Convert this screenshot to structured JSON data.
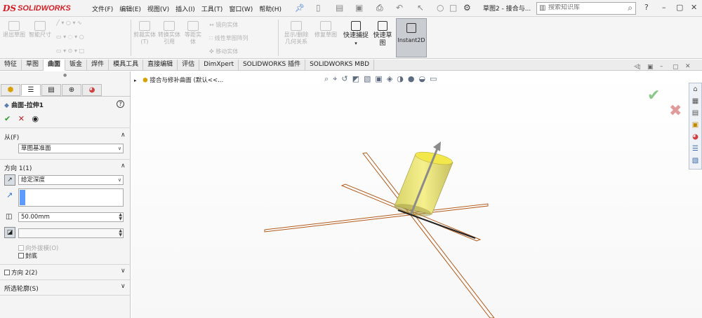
{
  "app": {
    "logo_mark": "DS",
    "logo_text": "SOLIDWORKS",
    "brand_color": "#d32027"
  },
  "menu": {
    "items": [
      "文件(F)",
      "编辑(E)",
      "视图(V)",
      "插入(I)",
      "工具(T)",
      "窗口(W)",
      "帮助(H)"
    ],
    "pin_icon": "pin-icon"
  },
  "titlebar": {
    "doc_title": "草图2 - 接合与...",
    "search_placeholder": "搜索知识库",
    "help": "?"
  },
  "ribbon": {
    "exit_sketch": "退出草图",
    "smart_dim": "智能尺寸",
    "trim": "剪裁实体(T)",
    "convert": "转换实体引用",
    "offset": "等距实体",
    "mirror": "镜向实体",
    "linear_pattern": "线性草图阵列",
    "move": "移动实体",
    "relations": "显示/删除几何关系",
    "repair": "修复草图",
    "snap": "快速捕捉",
    "quick_sketch": "快速草图",
    "instant2d": "Instant2D"
  },
  "tabs": [
    "特征",
    "草图",
    "曲面",
    "钣金",
    "焊件",
    "模具工具",
    "直接编辑",
    "评估",
    "DimXpert",
    "SOLIDWORKS 插件",
    "SOLIDWORKS MBD"
  ],
  "active_tab": "曲面",
  "pm": {
    "title": "曲面-拉伸1",
    "help": "?",
    "ok": "✔",
    "cancel": "✕",
    "from_label": "从(F)",
    "from_value": "草图基准面",
    "dir1_label": "方向 1(1)",
    "dir1_type": "给定深度",
    "depth": "50.00mm",
    "draft_label": "向外拔模(O)",
    "cap_label": "封底",
    "dir2_label": "方向 2(2)",
    "contours_label": "所选轮廓(S)"
  },
  "viewport": {
    "tree_title": "接合与修补曲面  (默认<<...",
    "accent_ok": "#8bc68b",
    "accent_cancel": "#e19a9a"
  }
}
